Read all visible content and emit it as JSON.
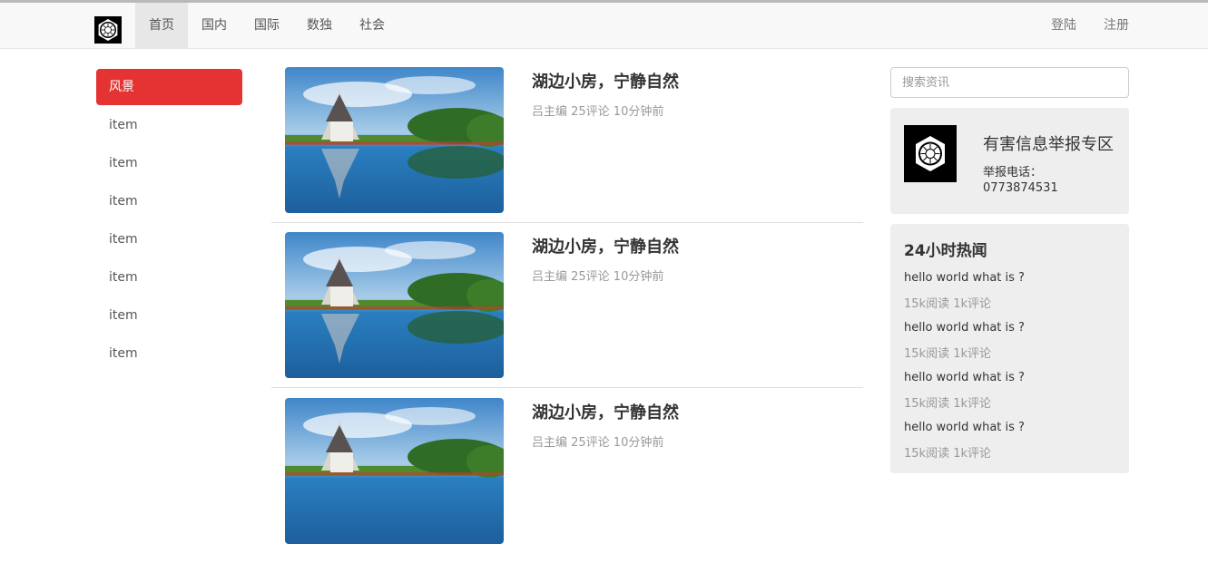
{
  "navbar": {
    "brand_icon": "hexagon-logo-icon",
    "items": [
      {
        "label": "首页",
        "active": true
      },
      {
        "label": "国内",
        "active": false
      },
      {
        "label": "国际",
        "active": false
      },
      {
        "label": "数独",
        "active": false
      },
      {
        "label": "社会",
        "active": false
      }
    ],
    "right": [
      {
        "label": "登陆"
      },
      {
        "label": "注册"
      }
    ]
  },
  "sidebar": {
    "items": [
      {
        "label": "风景",
        "active": true
      },
      {
        "label": "item",
        "active": false
      },
      {
        "label": "item",
        "active": false
      },
      {
        "label": "item",
        "active": false
      },
      {
        "label": "item",
        "active": false
      },
      {
        "label": "item",
        "active": false
      },
      {
        "label": "item",
        "active": false
      },
      {
        "label": "item",
        "active": false
      }
    ],
    "active_color": "#e53333"
  },
  "articles": [
    {
      "title": "湖边小房，宁静自然",
      "meta": "吕主编 25评论 10分钟前"
    },
    {
      "title": "湖边小房，宁静自然",
      "meta": "吕主编 25评论 10分钟前"
    },
    {
      "title": "湖边小房，宁静自然",
      "meta": "吕主编 25评论 10分钟前"
    }
  ],
  "search": {
    "placeholder": "搜索资讯"
  },
  "report": {
    "title": "有害信息举报专区",
    "phone_label": "举报电话：",
    "phone": "0773874531"
  },
  "hot": {
    "title": "24小时热闻",
    "items": [
      {
        "title": "hello world what is ?",
        "meta": "15k阅读 1k评论"
      },
      {
        "title": "hello world what is ?",
        "meta": "15k阅读 1k评论"
      },
      {
        "title": "hello world what is ?",
        "meta": "15k阅读 1k评论"
      },
      {
        "title": "hello world what is ?",
        "meta": "15k阅读 1k评论"
      }
    ]
  }
}
